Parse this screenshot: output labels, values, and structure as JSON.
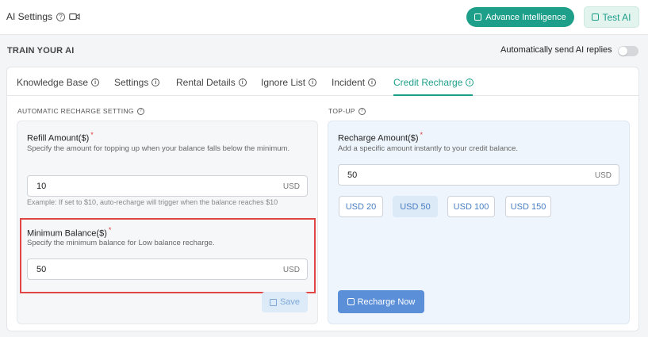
{
  "header": {
    "title": "AI Settings",
    "advance_button": "Advance Intelligence",
    "test_button": "Test AI"
  },
  "train": {
    "title": "TRAIN YOUR AI",
    "auto_send_label": "Automatically send AI replies",
    "auto_send_enabled": false
  },
  "tabs": [
    {
      "label": "Knowledge Base",
      "active": false
    },
    {
      "label": "Settings",
      "active": false
    },
    {
      "label": "Rental Details",
      "active": false
    },
    {
      "label": "Ignore List",
      "active": false
    },
    {
      "label": "Incident",
      "active": false
    },
    {
      "label": "Credit Recharge",
      "active": true
    }
  ],
  "auto_recharge": {
    "section_title": "AUTOMATIC RECHARGE SETTING",
    "refill": {
      "label": "Refill Amount($)",
      "required_mark": "*",
      "description": "Specify the amount for topping up when your balance falls below the minimum.",
      "value": "10",
      "unit": "USD",
      "example": "Example: If set to $10, auto-recharge will trigger when the balance reaches $10"
    },
    "minimum": {
      "label": "Minimum Balance($)",
      "required_mark": "*",
      "description": "Specify the minimum balance for Low balance recharge.",
      "value": "50",
      "unit": "USD"
    },
    "save_button": "Save"
  },
  "topup": {
    "section_title": "TOP-UP",
    "recharge": {
      "label": "Recharge Amount($)",
      "required_mark": "*",
      "description": "Add a specific amount instantly to your credit balance.",
      "value": "50",
      "unit": "USD"
    },
    "amount_options": [
      "USD 20",
      "USD 50",
      "USD 100",
      "USD 150"
    ],
    "selected_option": "USD 50",
    "recharge_button": "Recharge Now"
  },
  "colors": {
    "brand": "#1e9f89",
    "primary_button": "#5b8fd8",
    "highlight_border": "#e04646"
  }
}
